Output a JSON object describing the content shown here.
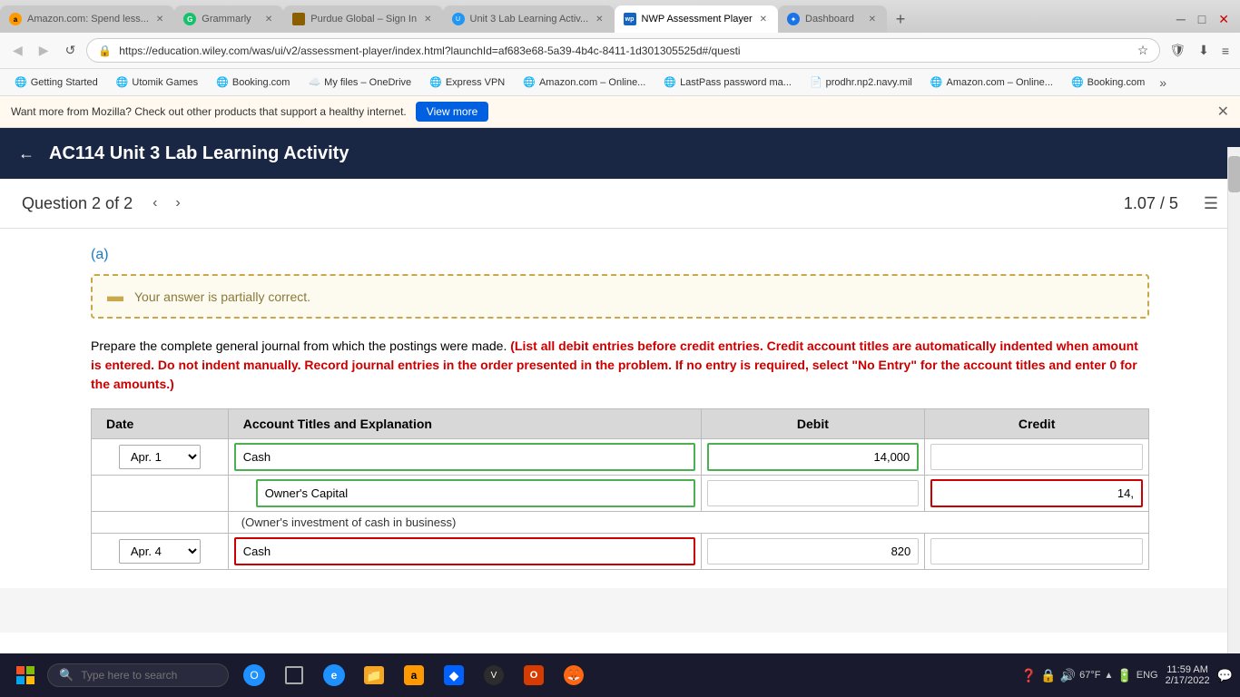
{
  "browser": {
    "tabs": [
      {
        "id": "amazon",
        "label": "Amazon.com: Spend less...",
        "favicon_class": "fav-amazon",
        "active": false,
        "closable": true
      },
      {
        "id": "grammarly",
        "label": "Grammarly",
        "favicon_class": "fav-grammarly",
        "active": false,
        "closable": true
      },
      {
        "id": "purdue",
        "label": "Purdue Global – Sign In",
        "favicon_class": "fav-purdue",
        "active": false,
        "closable": true
      },
      {
        "id": "unit3",
        "label": "Unit 3 Lab Learning Activ...",
        "favicon_class": "fav-unit3",
        "active": false,
        "closable": true
      },
      {
        "id": "nwp",
        "label": "NWP Assessment Player",
        "favicon_class": "fav-nwp",
        "active": true,
        "closable": true
      },
      {
        "id": "dashboard",
        "label": "Dashboard",
        "favicon_class": "fav-dashboard",
        "active": false,
        "closable": true
      }
    ],
    "address": "https://education.wiley.com/was/ui/v2/assessment-player/index.html?launchId=af683e68-5a39-4b4c-8411-1d301305525d#/questi",
    "bookmarks": [
      {
        "label": "Getting Started",
        "icon": "🌐"
      },
      {
        "label": "Utomik Games",
        "icon": "🌐"
      },
      {
        "label": "Booking.com",
        "icon": "🌐"
      },
      {
        "label": "My files – OneDrive",
        "icon": "☁️"
      },
      {
        "label": "Express VPN",
        "icon": "🌐"
      },
      {
        "label": "Amazon.com – Online...",
        "icon": "🌐"
      },
      {
        "label": "LastPass password ma...",
        "icon": "🌐"
      },
      {
        "label": "prodhr.np2.navy.mil",
        "icon": "📄"
      },
      {
        "label": "Amazon.com – Online...",
        "icon": "🌐"
      },
      {
        "label": "Booking.com",
        "icon": "🌐"
      }
    ],
    "notification": "Want more from Mozilla? Check out other products that support a healthy internet.",
    "view_more_label": "View more"
  },
  "page_header": {
    "back_label": "←",
    "title": "AC114 Unit 3 Lab Learning Activity"
  },
  "question": {
    "label": "Question 2 of 2",
    "score": "1.07 / 5"
  },
  "content": {
    "part_label": "(a)",
    "alert_text": "Your answer is partially correct.",
    "instructions_plain": "Prepare the complete general journal from which the postings were made.",
    "instructions_red": "(List all debit entries before credit entries. Credit account titles are automatically indented when amount is entered. Do not indent manually. Record journal entries in the order presented in the problem. If no entry is required, select \"No Entry\" for the account titles and enter 0 for the amounts.)",
    "table": {
      "headers": [
        "Date",
        "Account Titles and Explanation",
        "Debit",
        "Credit"
      ],
      "rows": [
        {
          "date": "Apr. 1",
          "date_select": true,
          "accounts": [
            {
              "name": "Cash",
              "debit": "14,000",
              "credit": "",
              "account_border": "green",
              "debit_border": "green",
              "credit_border": "none"
            },
            {
              "name": "Owner's Capital",
              "debit": "",
              "credit": "14,",
              "account_border": "green",
              "debit_border": "none",
              "credit_border": "red",
              "indent": true
            }
          ],
          "description": "(Owner's investment of cash in business)"
        },
        {
          "date": "Apr. 4",
          "date_select": true,
          "accounts": [
            {
              "name": "Cash",
              "debit": "820",
              "credit": "",
              "account_border": "red",
              "debit_border": "none",
              "credit_border": "none"
            }
          ]
        }
      ]
    }
  },
  "taskbar": {
    "search_placeholder": "Type here to search",
    "time": "11:59 AM",
    "date": "2/17/2022",
    "temp": "67°F"
  }
}
